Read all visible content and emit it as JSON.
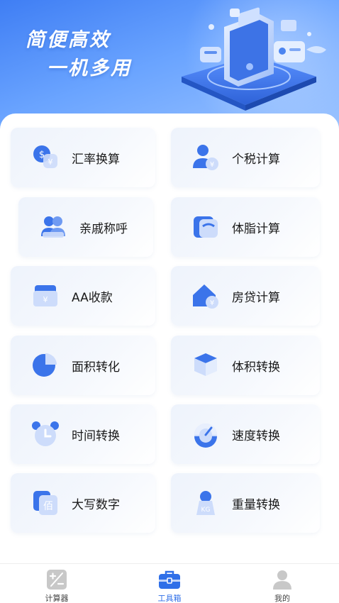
{
  "banner": {
    "slogan_line1": "简便高效",
    "slogan_line2": "一机多用"
  },
  "tools": [
    {
      "label": "汇率换算",
      "icon": "currency-exchange-icon"
    },
    {
      "label": "个税计算",
      "icon": "personal-tax-icon"
    },
    {
      "label": "亲戚称呼",
      "icon": "relatives-icon"
    },
    {
      "label": "体脂计算",
      "icon": "body-fat-scale-icon"
    },
    {
      "label": "AA收款",
      "icon": "wallet-icon"
    },
    {
      "label": "房贷计算",
      "icon": "mortgage-house-icon"
    },
    {
      "label": "面积转化",
      "icon": "area-pie-icon"
    },
    {
      "label": "体积转换",
      "icon": "volume-cube-icon"
    },
    {
      "label": "时间转换",
      "icon": "alarm-clock-icon"
    },
    {
      "label": "速度转换",
      "icon": "speedometer-icon"
    },
    {
      "label": "大写数字",
      "icon": "capital-number-icon"
    },
    {
      "label": "重量转换",
      "icon": "weight-kg-icon"
    }
  ],
  "tabbar": {
    "calculator": "计算器",
    "toolbox": "工具箱",
    "mine": "我的"
  },
  "colors": {
    "accent": "#2f6fe8",
    "icon_blue": "#3b74ea",
    "card_bg": "#eef3fc"
  }
}
